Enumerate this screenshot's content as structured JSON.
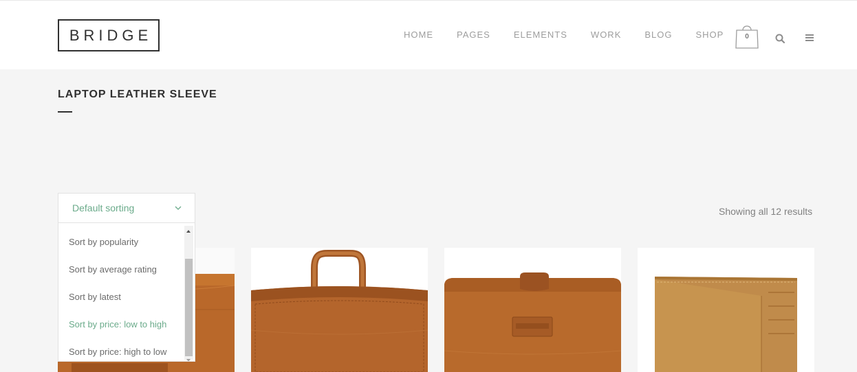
{
  "header": {
    "logo_text": "BRIDGE",
    "nav": [
      "HOME",
      "PAGES",
      "ELEMENTS",
      "WORK",
      "BLOG",
      "SHOP"
    ],
    "cart_count": "0",
    "icons": [
      "shopping-bag-icon",
      "search-icon",
      "menu-icon"
    ]
  },
  "page": {
    "title": "LAPTOP LEATHER SLEEVE"
  },
  "shop": {
    "result_count": "Showing all 12 results",
    "sort": {
      "selected": "Default sorting",
      "options": [
        "Sort by popularity",
        "Sort by average rating",
        "Sort by latest",
        "Sort by price: low to high",
        "Sort by price: high to low"
      ],
      "highlighted_option": "Sort by price: low to high"
    }
  },
  "colors": {
    "accent": "#6bab8b",
    "text_dark": "#303030",
    "nav_gray": "#9d9d9d",
    "page_bg": "#f5f5f5",
    "leather": "#b9682a"
  }
}
